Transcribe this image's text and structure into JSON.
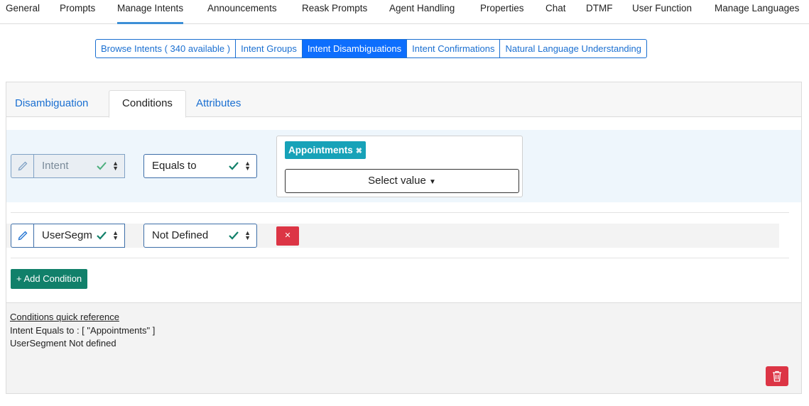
{
  "top_tabs": [
    "General",
    "Prompts",
    "Manage Intents",
    "Announcements",
    "Reask Prompts",
    "Agent Handling",
    "Properties",
    "Chat",
    "DTMF",
    "User Function",
    "Manage Languages"
  ],
  "sub_tabs": [
    "Browse Intents ( 340 available )",
    "Intent Groups",
    "Intent Disambiguations",
    "Intent Confirmations",
    "Natural Language Understanding"
  ],
  "panel_tabs": [
    "Disambiguation",
    "Conditions",
    "Attributes"
  ],
  "conditions": [
    {
      "field": "Intent",
      "operator": "Equals to",
      "chip": "Appointments",
      "chip_remove": "✖",
      "value_placeholder": "Select value"
    },
    {
      "field": "UserSegm",
      "operator": "Not Defined",
      "remove_label": "✕"
    }
  ],
  "add_condition_label": "+ Add Condition",
  "quick_ref": {
    "title": "Conditions quick reference",
    "lines": [
      {
        "key": "Intent",
        "text": " Equals to : [ \"Appointments\" ]"
      },
      {
        "key": "UserSegment",
        "text": " Not defined"
      }
    ]
  },
  "colors": {
    "accent": "#0d6efd",
    "chip": "#17a2b8",
    "danger": "#dc3545",
    "success": "#11806a"
  }
}
